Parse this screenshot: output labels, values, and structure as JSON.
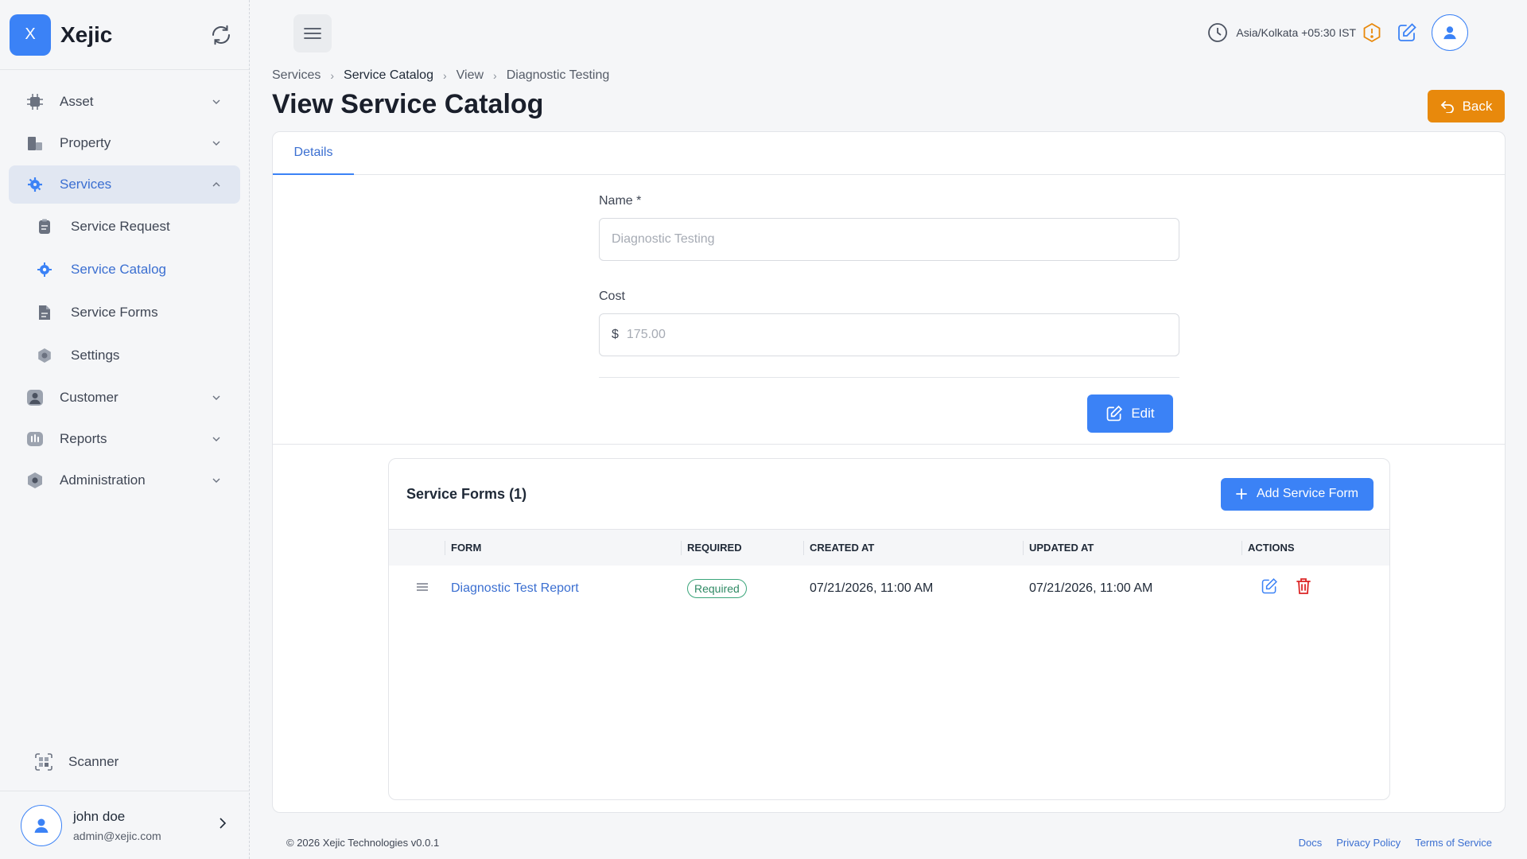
{
  "brand": {
    "logo_letter": "X",
    "name": "Xejic"
  },
  "sidebar": {
    "items": [
      {
        "label": "Asset",
        "icon": "chip-icon"
      },
      {
        "label": "Property",
        "icon": "building-icon"
      },
      {
        "label": "Services",
        "icon": "services-gear-icon",
        "active": true,
        "children": [
          {
            "label": "Service Request",
            "icon": "clipboard-icon"
          },
          {
            "label": "Service Catalog",
            "icon": "catalog-icon",
            "active": true
          },
          {
            "label": "Service Forms",
            "icon": "document-icon"
          },
          {
            "label": "Settings",
            "icon": "cog-icon"
          }
        ]
      },
      {
        "label": "Customer",
        "icon": "user-square-icon"
      },
      {
        "label": "Reports",
        "icon": "chart-icon"
      },
      {
        "label": "Administration",
        "icon": "shield-icon"
      }
    ],
    "scanner_label": "Scanner",
    "user": {
      "name": "john doe",
      "email": "admin@xejic.com"
    }
  },
  "topbar": {
    "timezone": "Asia/Kolkata +05:30 IST"
  },
  "breadcrumb": [
    "Services",
    "Service Catalog",
    "View",
    "Diagnostic Testing"
  ],
  "page_title": "View Service Catalog",
  "back_label": "Back",
  "tabs": [
    "Details"
  ],
  "form": {
    "name_label": "Name",
    "required_mark": "*",
    "name_value": "Diagnostic Testing",
    "cost_label": "Cost",
    "currency": "$",
    "cost_value": "175.00",
    "edit_label": "Edit"
  },
  "service_forms": {
    "title": "Service Forms (1)",
    "add_label": "Add Service Form",
    "columns": [
      "FORM",
      "REQUIRED",
      "CREATED AT",
      "UPDATED AT",
      "ACTIONS"
    ],
    "rows": [
      {
        "form": "Diagnostic Test Report",
        "required": "Required",
        "created_at": "07/21/2026, 11:00 AM",
        "updated_at": "07/21/2026, 11:00 AM"
      }
    ]
  },
  "footer": {
    "copyright": "© 2026 Xejic Technologies v0.0.1",
    "links": [
      "Docs",
      "Privacy Policy",
      "Terms of Service"
    ]
  },
  "colors": {
    "primary": "#3b82f6",
    "warning": "#e8890c",
    "danger": "#dc2626",
    "success": "#2f8a64"
  }
}
